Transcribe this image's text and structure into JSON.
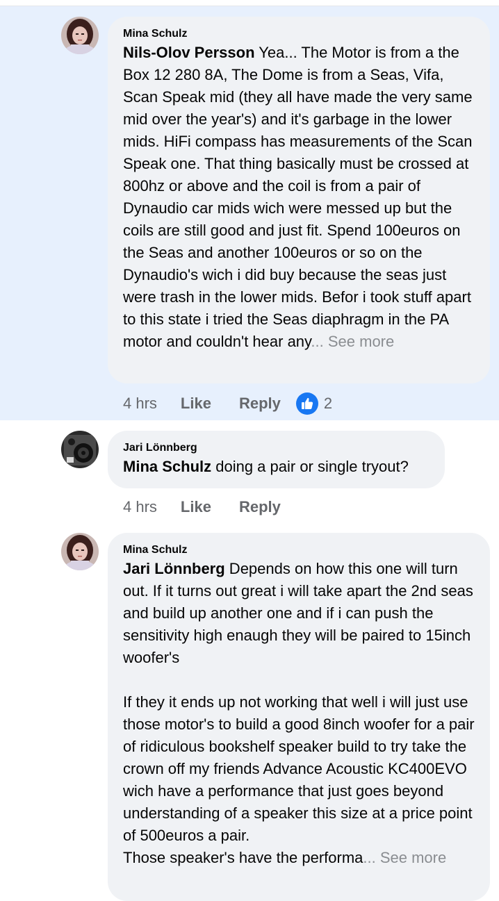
{
  "comments": [
    {
      "author": "Mina Schulz",
      "mention": "Nils-Olov Persson",
      "text": " Yea... The Motor is from a the Box 12 280 8A, The Dome is from a Seas, Vifa, Scan Speak mid (they all have made the very same mid over the year's) and it's garbage in the lower mids. HiFi compass has measurements of the Scan Speak one. That thing basically must be crossed at 800hz or above and the coil is from a pair of Dynaudio car mids wich were messed up but the coils are still good and just fit. Spend 100euros on the Seas and another 100euros or so on the Dynaudio's wich i did buy because the seas just were trash in the lower mids. Befor i took stuff apart to this state i tried the Seas diaphragm in the PA motor and couldn't hear any",
      "see_more": "... See more",
      "time": "4 hrs",
      "like": "Like",
      "reply": "Reply",
      "reaction_count": "2"
    },
    {
      "author": "Jari Lönnberg",
      "mention": "Mina Schulz",
      "text": " doing a pair or single tryout?",
      "time": "4 hrs",
      "like": "Like",
      "reply": "Reply"
    },
    {
      "author": "Mina Schulz",
      "mention": "Jari Lönnberg",
      "text": " Depends on how this one will turn out. If it turns out great i will take apart the 2nd seas and build up another one and if i can push the sensitivity high enaugh they will be paired to 15inch woofer's",
      "text2": "If they it ends up not working that well i will just use those motor's to build a good 8inch woofer for a pair of ridiculous bookshelf speaker build to try take the crown off my friends Advance Acoustic KC400EVO wich have a performance that just goes beyond understanding of a speaker this size at a price point of 500euros a pair.",
      "text3": "Those speaker's have the performa",
      "see_more": "... See more"
    }
  ],
  "colors": {
    "highlight": "#e7f0fd",
    "bubble": "#f0f2f5",
    "like_blue": "#1877f2",
    "meta_gray": "#65676b"
  },
  "icons": {
    "reaction": "thumbs-up-icon"
  }
}
